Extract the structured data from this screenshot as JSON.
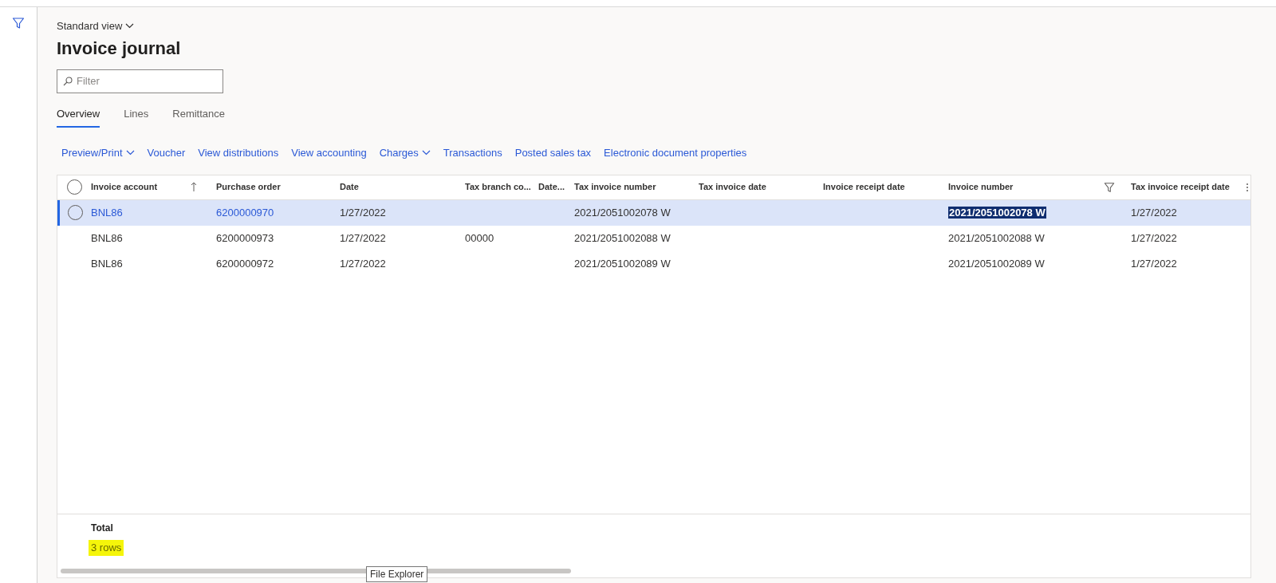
{
  "view_selector": {
    "label": "Standard view"
  },
  "page_title": "Invoice journal",
  "filter": {
    "placeholder": "Filter"
  },
  "tabs": [
    {
      "label": "Overview",
      "selected": true
    },
    {
      "label": "Lines",
      "selected": false
    },
    {
      "label": "Remittance",
      "selected": false
    }
  ],
  "action_bar": [
    {
      "label": "Preview/Print",
      "dropdown": true
    },
    {
      "label": "Voucher",
      "dropdown": false
    },
    {
      "label": "View distributions",
      "dropdown": false
    },
    {
      "label": "View accounting",
      "dropdown": false
    },
    {
      "label": "Charges",
      "dropdown": true
    },
    {
      "label": "Transactions",
      "dropdown": false
    },
    {
      "label": "Posted sales tax",
      "dropdown": false
    },
    {
      "label": "Electronic document properties",
      "dropdown": false
    }
  ],
  "grid": {
    "select_all": false,
    "columns": [
      {
        "label": "Invoice account",
        "sorted": true,
        "filtered": false
      },
      {
        "label": "Purchase order",
        "sorted": false,
        "filtered": false
      },
      {
        "label": "Date",
        "sorted": false,
        "filtered": false
      },
      {
        "label": "Tax branch co...",
        "sorted": false,
        "filtered": false
      },
      {
        "label": "Date...",
        "sorted": false,
        "filtered": false
      },
      {
        "label": "Tax invoice number",
        "sorted": false,
        "filtered": false
      },
      {
        "label": "Tax invoice date",
        "sorted": false,
        "filtered": false
      },
      {
        "label": "Invoice receipt date",
        "sorted": false,
        "filtered": false
      },
      {
        "label": "Invoice number",
        "sorted": false,
        "filtered": true
      },
      {
        "label": "Tax invoice receipt date",
        "sorted": false,
        "filtered": false
      }
    ],
    "rows": [
      {
        "selected": true,
        "cells": [
          "BNL86",
          "6200000970",
          "1/27/2022",
          "",
          "",
          "2021/2051002078 W",
          "",
          "",
          "2021/2051002078 W",
          "1/27/2022"
        ]
      },
      {
        "selected": false,
        "cells": [
          "BNL86",
          "6200000973",
          "1/27/2022",
          "00000",
          "",
          "2021/2051002088 W",
          "",
          "",
          "2021/2051002088 W",
          "1/27/2022"
        ]
      },
      {
        "selected": false,
        "cells": [
          "BNL86",
          "6200000972",
          "1/27/2022",
          "",
          "",
          "2021/2051002089 W",
          "",
          "",
          "2021/2051002089 W",
          "1/27/2022"
        ]
      }
    ],
    "footer": {
      "label": "Total",
      "count": "3 rows",
      "highlighted": true
    }
  },
  "tooltip": "File Explorer"
}
